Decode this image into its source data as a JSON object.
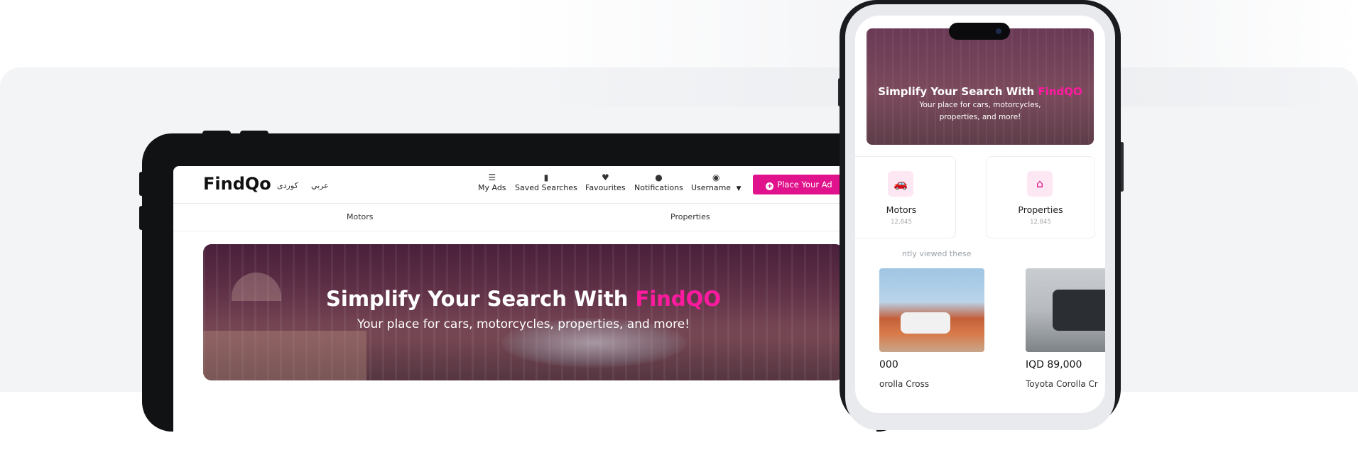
{
  "tablet": {
    "logo": "FindQo",
    "lang_kurdish": "کوردی",
    "lang_arabic": "عربي",
    "nav": [
      {
        "label": "My Ads",
        "icon": "list-icon"
      },
      {
        "label": "Saved Searches",
        "icon": "bookmark-icon"
      },
      {
        "label": "Favourites",
        "icon": "heart-icon"
      },
      {
        "label": "Notifications",
        "icon": "bell-icon"
      },
      {
        "label": "Username",
        "icon": "user-icon"
      }
    ],
    "place_ad": "Place Your Ad",
    "categories": [
      "Motors",
      "Properties"
    ],
    "hero": {
      "title_prefix": "Simplify Your Search With ",
      "title_brand": "FindQO",
      "subtitle": "Your place for cars, motorcycles, properties, and more!"
    }
  },
  "phone": {
    "hero": {
      "title_prefix": "Simplify Your Search With ",
      "title_brand": "FindQO",
      "subtitle": "Your place for cars, motorcycles, properties, and more!"
    },
    "cards": [
      {
        "label": "Motors",
        "count": "12,845",
        "icon": "car-icon"
      },
      {
        "label": "Properties",
        "count": "12,845",
        "icon": "home-icon"
      }
    ],
    "recently_viewed": "ntly viewed these",
    "listings": [
      {
        "price": "000",
        "name": "orolla Cross"
      },
      {
        "price": "IQD 89,000",
        "name": "Toyota Corolla Cr"
      }
    ]
  },
  "colors": {
    "brand": "#e0138c",
    "dark_frame": "#111214"
  }
}
